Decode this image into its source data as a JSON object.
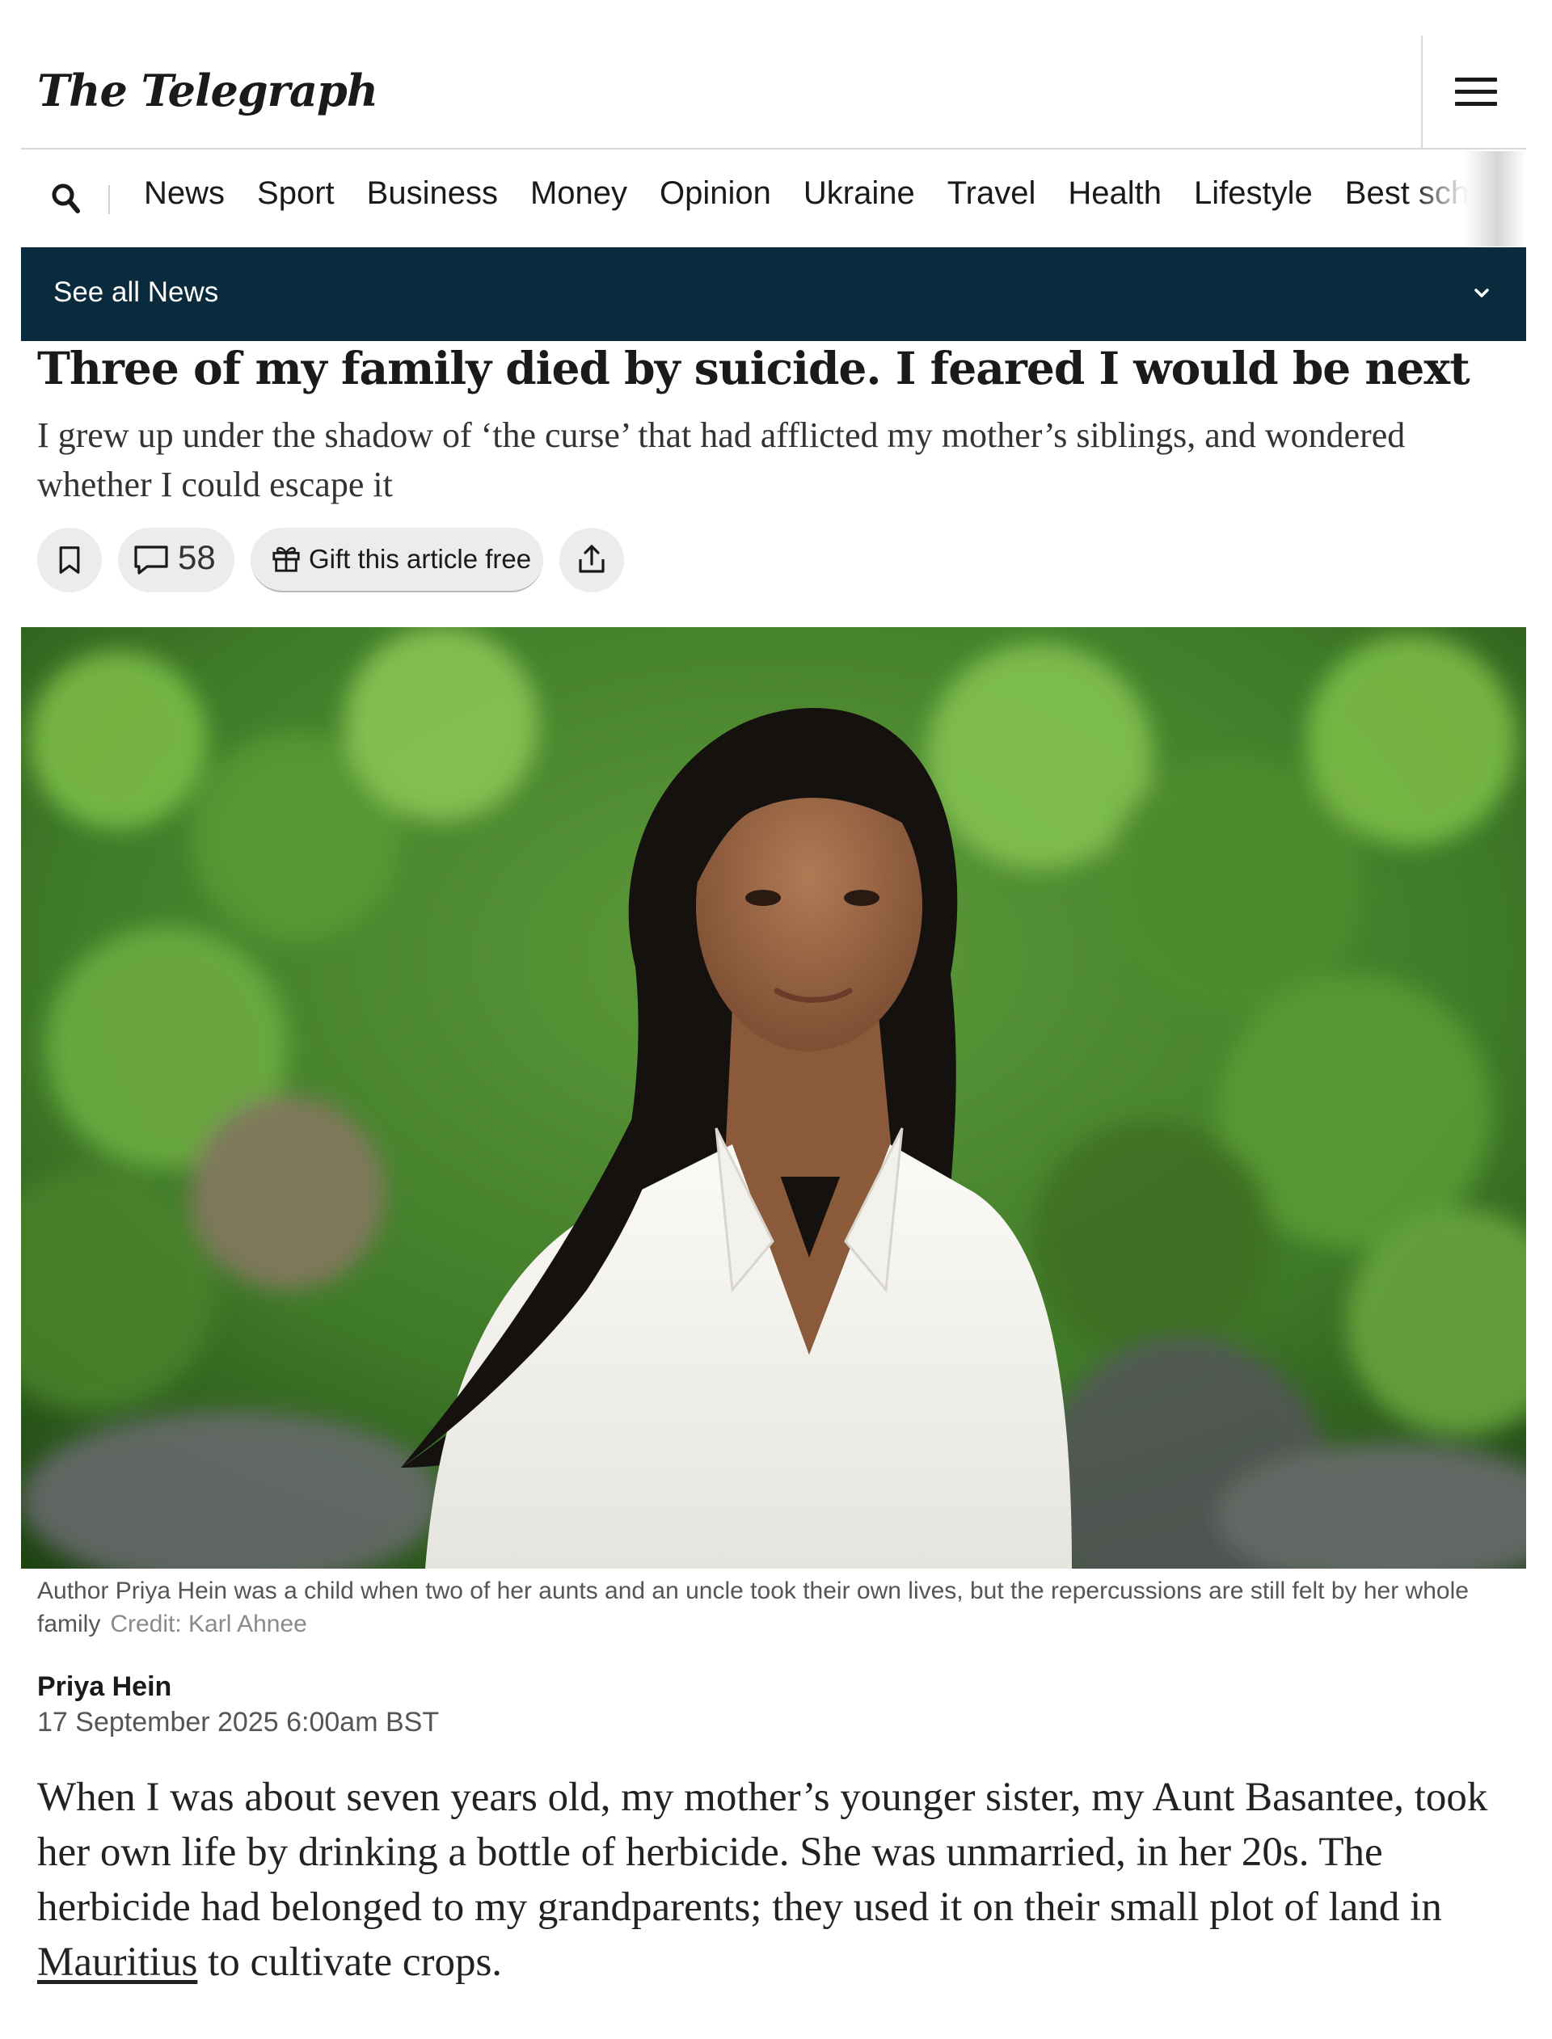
{
  "masthead": {
    "logo": "The Telegraph"
  },
  "nav": {
    "items": [
      "News",
      "Sport",
      "Business",
      "Money",
      "Opinion",
      "Ukraine",
      "Travel",
      "Health",
      "Lifestyle",
      "Best sch"
    ]
  },
  "section_bar": {
    "label": "See all News",
    "bg_color": "#0a2a3d"
  },
  "article": {
    "headline": "Three of my family died by suicide. I feared I would be next",
    "standfirst": "I grew up under the shadow of ‘the curse’ that had afflicted my mother’s siblings, and wondered whether I could escape it",
    "comment_count": "58",
    "gift_label": "Gift this article free",
    "caption": "Author Priya Hein was a child when two of her aunts and an uncle took their own lives, but the repercussions are still felt by her whole family",
    "credit": "Credit: Karl Ahnee",
    "author": "Priya Hein",
    "date": "17 September 2025 6:00am BST",
    "body_before": "When I was about seven years old, my mother’s younger sister, my Aunt Basantee, took her own life by drinking a bottle of herbicide. She was unmarried, in her 20s. The herbicide had belonged to my grandparents; they used it on their small plot of land in ",
    "body_link": "Mauritius",
    "body_after": " to cultivate crops."
  },
  "icons": [
    "menu-icon",
    "search-icon",
    "chevron-down-icon",
    "bookmark-icon",
    "comment-icon",
    "gift-icon",
    "share-icon"
  ]
}
